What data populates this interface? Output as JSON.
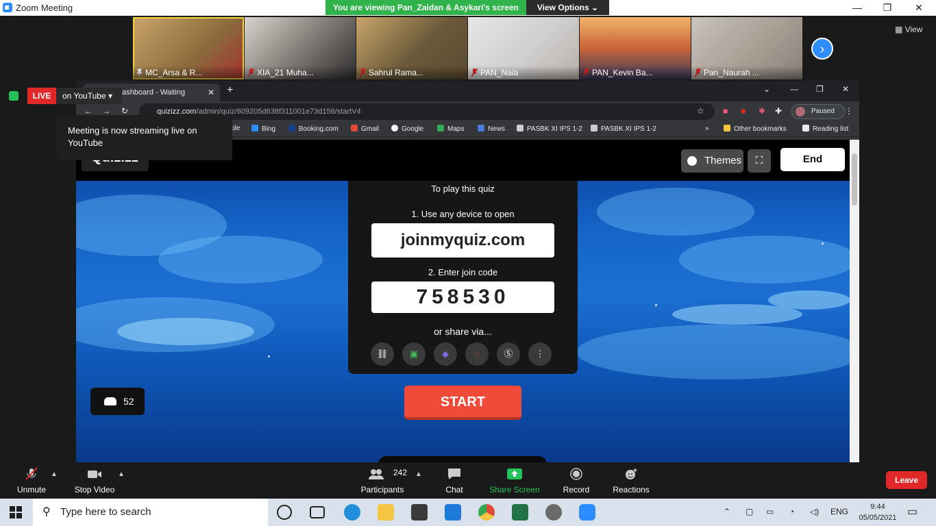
{
  "window": {
    "title": "Zoom Meeting"
  },
  "banner": {
    "viewing": "You are viewing Pan_Zaidan & Asykari's screen",
    "view_options": "View Options"
  },
  "strip": {
    "view_label": "View",
    "participants": [
      {
        "name": "MC_Arsa & R..."
      },
      {
        "name": "XIA_21 Muha..."
      },
      {
        "name": "Sahrul Rama..."
      },
      {
        "name": "PAN_Naia"
      },
      {
        "name": "PAN_Kevin Ba..."
      },
      {
        "name": "Pan_Naurah ..."
      }
    ]
  },
  "live": {
    "badge": "LIVE",
    "platform": "on YouTube",
    "tooltip": "Meeting is now streaming live on YouTube"
  },
  "browser": {
    "tab_title": "Live Dashboard - Waiting",
    "url_host": "quizizz.com",
    "url_path": "/admin/quiz/609205d638f311001e73d156/startV4",
    "profile_status": "Paused",
    "bookmarks": [
      "ple",
      "Bing",
      "Booking.com",
      "Gmail",
      "Google",
      "Maps",
      "News",
      "PASBK XI IPS 1-2",
      "PASBK XI IPS 1-2"
    ],
    "other_bookmarks": "Other bookmarks",
    "reading_list": "Reading list"
  },
  "quiz": {
    "logo": "Quizizz",
    "themes_label": "Themes",
    "end_label": "End",
    "play_heading": "To play this quiz",
    "step1": "1. Use any device to open",
    "join_site": "joinmyquiz.com",
    "step2": "2. Enter join code",
    "join_code": "758530",
    "share_label": "or share via...",
    "start_label": "START",
    "player_count": "52"
  },
  "toolbar": {
    "unmute": "Unmute",
    "stop_video": "Stop Video",
    "participants": "Participants",
    "participant_count": "242",
    "chat": "Chat",
    "share_screen": "Share Screen",
    "record": "Record",
    "reactions": "Reactions",
    "leave": "Leave"
  },
  "taskbar": {
    "search_placeholder": "Type here to search",
    "language": "ENG",
    "time": "9:44",
    "date": "05/05/2021"
  },
  "colors": {
    "zoom_blue": "#2d8cff",
    "banner_green": "#2fb34a",
    "live_red": "#e02828",
    "start_red": "#ef4a3a",
    "share_screen_green": "#23c15a"
  }
}
